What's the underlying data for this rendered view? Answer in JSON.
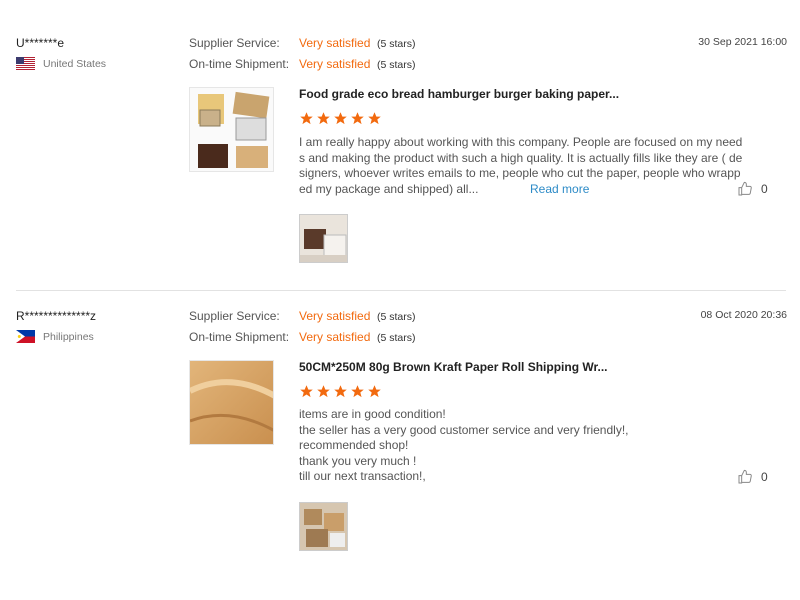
{
  "reviews": [
    {
      "user": "U*******e",
      "country": "United States",
      "flag": "us-flag-icon",
      "supplier_service_label": "Supplier Service:",
      "supplier_service_value": "Very satisfied",
      "supplier_service_stars": "(5 stars)",
      "shipment_label": "On-time Shipment:",
      "shipment_value": "Very satisfied",
      "shipment_stars": "(5 stars)",
      "date": "30 Sep 2021 16:00",
      "product_title": "Food grade eco bread hamburger burger baking paper...",
      "rating": 5,
      "text_lines": [
        "I am really happy about working with this company. People are focused on my need",
        "s and making the product with such a high quality. It is actually fills like they are ( de",
        "signers, whoever writes emails to me, people who cut the paper, people who wrapp",
        "ed my package and shipped) all..."
      ],
      "read_more": "Read more",
      "likes": "0"
    },
    {
      "user": "R**************z",
      "country": "Philippines",
      "flag": "ph-flag-icon",
      "supplier_service_label": "Supplier Service:",
      "supplier_service_value": "Very satisfied",
      "supplier_service_stars": "(5 stars)",
      "shipment_label": "On-time Shipment:",
      "shipment_value": "Very satisfied",
      "shipment_stars": "(5 stars)",
      "date": "08 Oct 2020 20:36",
      "product_title": "50CM*250M 80g Brown Kraft Paper Roll Shipping Wr...",
      "rating": 5,
      "text_lines": [
        "items are in good condition!",
        "the seller has a very good customer service and very friendly!,",
        "recommended shop!",
        "thank you very much !",
        "till our next transaction!,"
      ],
      "likes": "0"
    }
  ],
  "colors": {
    "accent": "#f26a0f",
    "link": "#2d8bc7",
    "divider": "#e2e2e2"
  }
}
